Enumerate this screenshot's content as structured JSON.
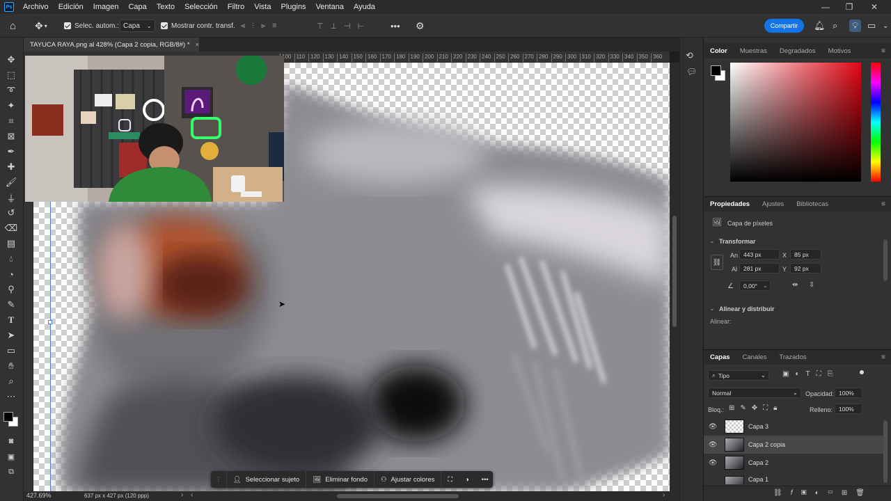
{
  "app": {
    "logo": "Ps"
  },
  "menu": [
    "Archivo",
    "Edición",
    "Imagen",
    "Capa",
    "Texto",
    "Selección",
    "Filtro",
    "Vista",
    "Plugins",
    "Ventana",
    "Ayuda"
  ],
  "options": {
    "auto_select_label": "Selec. autom.:",
    "auto_select_value": "Capa",
    "show_transform_label": "Mostrar contr. transf.",
    "more": "•••",
    "share": "Compartir"
  },
  "document": {
    "tab_title": "TAYUCA RAYA.png al 428% (Capa 2 copia, RGB/8#) *",
    "close": "×"
  },
  "ruler": {
    "top_ticks": [
      "100",
      "110",
      "120",
      "130",
      "140",
      "150",
      "160",
      "170",
      "180",
      "190",
      "200",
      "210",
      "220",
      "230",
      "240",
      "250",
      "260",
      "270",
      "280",
      "290",
      "300",
      "310",
      "320",
      "330",
      "340",
      "350",
      "360",
      "370",
      "380",
      "390"
    ]
  },
  "status": {
    "zoom": "427.69%",
    "doc_info": "637 px x 427 px (120 ppp)"
  },
  "panels": {
    "color": {
      "tabs": [
        "Color",
        "Muestras",
        "Degradados",
        "Motivos"
      ]
    },
    "properties": {
      "tabs": [
        "Propiedades",
        "Ajustes",
        "Bibliotecas"
      ],
      "layer_type": "Capa de píxeles",
      "transform_title": "Transformar",
      "w_label": "An",
      "w_value": "443 px",
      "h_label": "Al",
      "h_value": "281 px",
      "x_label": "X",
      "x_value": "85 px",
      "y_label": "Y",
      "y_value": "92 px",
      "angle": "0,00°",
      "align_title": "Alinear y distribuir",
      "align_label": "Alinear:"
    },
    "layers": {
      "tabs": [
        "Capas",
        "Canales",
        "Trazados"
      ],
      "filter": "Tipo",
      "blend_mode": "Normal",
      "opacity_label": "Opacidad:",
      "opacity_value": "100%",
      "lock_label": "Bloq.:",
      "fill_label": "Relleno:",
      "fill_value": "100%",
      "items": [
        {
          "name": "Capa 3",
          "visible": true,
          "selected": false
        },
        {
          "name": "Capa 2 copia",
          "visible": true,
          "selected": true
        },
        {
          "name": "Capa 2",
          "visible": true,
          "selected": false
        },
        {
          "name": "Capa 1",
          "visible": false,
          "selected": false
        }
      ]
    }
  },
  "context_bar": {
    "select_subject": "Seleccionar sujeto",
    "remove_bg": "Eliminar fondo",
    "adjust_colors": "Ajustar colores",
    "more": "•••"
  },
  "colors": {
    "accent": "#1473e6",
    "fg_swatch": "#000000",
    "bg_swatch": "#ffffff"
  }
}
